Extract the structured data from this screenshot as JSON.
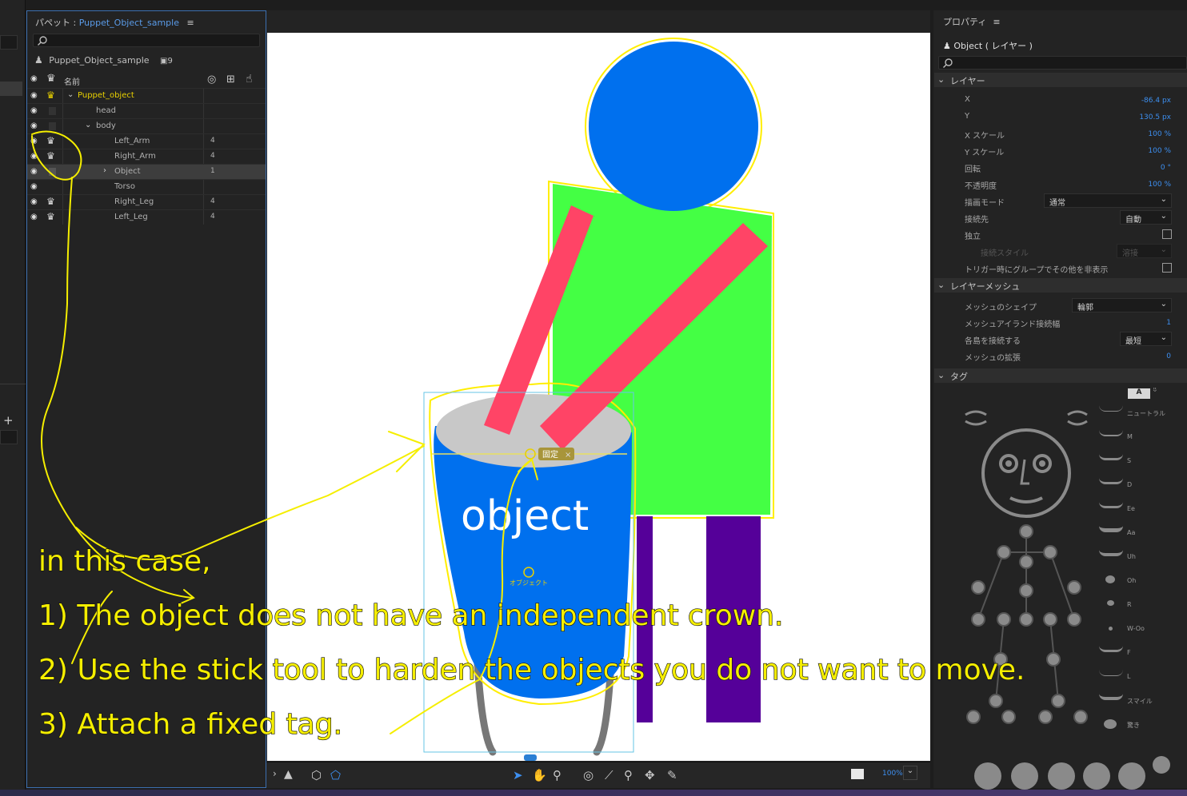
{
  "puppet_panel": {
    "title_prefix": "パペット :",
    "title_name": "Puppet_Object_sample",
    "menu_glyph": "≡",
    "puppet_name": "Puppet_Object_sample",
    "layer_count": "9",
    "col_name": "名前",
    "layers": [
      {
        "name": "Puppet_object",
        "count": "",
        "type": "group-root"
      },
      {
        "name": "head",
        "count": ""
      },
      {
        "name": "body",
        "count": ""
      },
      {
        "name": "Left_Arm",
        "count": "4"
      },
      {
        "name": "Right_Arm",
        "count": "4"
      },
      {
        "name": "Object",
        "count": "1"
      },
      {
        "name": "Torso",
        "count": ""
      },
      {
        "name": "Right_Leg",
        "count": "4"
      },
      {
        "name": "Left_Leg",
        "count": "4"
      }
    ]
  },
  "canvas": {
    "object_text": "object",
    "fixed_tag_label": "固定",
    "origin_label": "オブジェクト",
    "colors": {
      "head": "#0070ee",
      "torso": "#44ff44",
      "arm": "#ff4466",
      "leg": "#550099",
      "drum_lid": "#c8c8c8",
      "outline": "#ffee00"
    }
  },
  "annotation": {
    "lines": [
      "in this case,",
      "1) The object does not have an independent crown.",
      "2) Use the stick tool to harden the objects you do not want to move.",
      "3) Attach a fixed tag."
    ]
  },
  "toolbar": {
    "zoom": "100%"
  },
  "properties": {
    "title": "プロパティ",
    "menu_glyph": "≡",
    "selected": "Object ( レイヤー )",
    "section_layer": "レイヤー",
    "x_label": "X",
    "x_value": "-86.4 px",
    "y_label": "Y",
    "y_value": "130.5 px",
    "xscale_label": "X スケール",
    "xscale_value": "100 %",
    "yscale_label": "Y スケール",
    "yscale_value": "100 %",
    "rotation_label": "回転",
    "rotation_value": "0 °",
    "opacity_label": "不透明度",
    "opacity_value": "100 %",
    "blend_label": "描画モード",
    "blend_value": "通常",
    "attach_label": "接続先",
    "attach_value": "自動",
    "independent_label": "独立",
    "attach_style_label": "接続スタイル",
    "attach_style_value": "溶接",
    "trigger_label": "トリガー時にグループでその他を非表示",
    "section_mesh": "レイヤーメッシュ",
    "mesh_shape_label": "メッシュのシェイプ",
    "mesh_shape_value": "輪郭",
    "mesh_island_label": "メッシュアイランド接続幅",
    "mesh_island_value": "1",
    "connect_label": "各島を接続する",
    "connect_value": "最短",
    "expand_label": "メッシュの拡張",
    "expand_value": "0",
    "section_tag": "タグ",
    "tag_mode": "A",
    "mouth_tags": [
      "ニュートラル",
      "M",
      "S",
      "D",
      "Ee",
      "Aa",
      "Uh",
      "Oh",
      "R",
      "W-Oo",
      "F",
      "L",
      "スマイル",
      "驚き"
    ]
  }
}
